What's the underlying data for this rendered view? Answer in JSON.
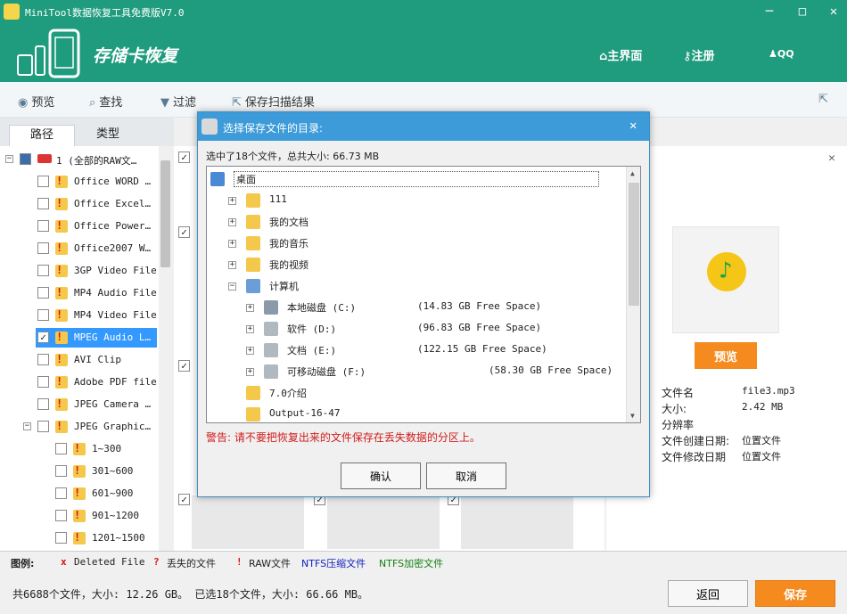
{
  "window": {
    "title": "MiniTool数据恢复工具免费版V7.0",
    "controls": [
      "─",
      "□",
      "✕"
    ]
  },
  "header": {
    "app_title": "存储卡恢复",
    "nav": {
      "home": "主界面",
      "register": "注册",
      "qq": "QQ"
    }
  },
  "toolbar": {
    "preview": "预览",
    "search": "查找",
    "filter": "过滤",
    "save_scan": "保存扫描结果"
  },
  "tabs": {
    "path": "路径",
    "type": "类型"
  },
  "tree": {
    "root": "1 (全部的RAW文…",
    "items": [
      {
        "label": "Office WORD …",
        "checked": false
      },
      {
        "label": "Office Excel…",
        "checked": false
      },
      {
        "label": "Office Power…",
        "checked": false
      },
      {
        "label": "Office2007 W…",
        "checked": false
      },
      {
        "label": "3GP Video File",
        "checked": false
      },
      {
        "label": "MP4 Audio File",
        "checked": false
      },
      {
        "label": "MP4 Video File",
        "checked": false
      },
      {
        "label": "MPEG Audio L…",
        "checked": true
      },
      {
        "label": "AVI Clip",
        "checked": false
      },
      {
        "label": "Adobe PDF file",
        "checked": false
      },
      {
        "label": "JPEG Camera …",
        "checked": false
      },
      {
        "label": "JPEG Graphic…",
        "checked": false
      }
    ],
    "subitems": [
      "1~300",
      "301~600",
      "601~900",
      "901~1200",
      "1201~1500"
    ]
  },
  "preview": {
    "button": "预览",
    "info": [
      {
        "label": "文件名",
        "value": "file3.mp3"
      },
      {
        "label": "大小:",
        "value": "2.42 MB"
      },
      {
        "label": "分辨率",
        "value": ""
      },
      {
        "label": "文件创建日期:",
        "value": "位置文件"
      },
      {
        "label": "文件修改日期",
        "value": "位置文件"
      }
    ]
  },
  "legend": {
    "title": "图例:",
    "deleted": "Deleted File",
    "lost": "丢失的文件",
    "raw": "RAW文件",
    "ntfs_comp": "NTFS压缩文件",
    "ntfs_enc": "NTFS加密文件",
    "colors": {
      "deleted": "#e01010",
      "lost": "#e01010",
      "raw": "#e01010",
      "ntfs_comp": "#1020c0",
      "ntfs_enc": "#108010"
    }
  },
  "status": {
    "text": "共6688个文件，大小: 12.26 GB。 已选18个文件，大小: 66.66 MB。",
    "back": "返回",
    "save": "保存"
  },
  "dialog": {
    "title": "选择保存文件的目录:",
    "summary": "选中了18个文件，总共大小: 66.73 MB",
    "tree": [
      {
        "label": "桌面",
        "free": ""
      },
      {
        "label": "111",
        "free": ""
      },
      {
        "label": "我的文档",
        "free": ""
      },
      {
        "label": "我的音乐",
        "free": ""
      },
      {
        "label": "我的视频",
        "free": ""
      },
      {
        "label": "计算机",
        "free": ""
      },
      {
        "label": "本地磁盘 (C:)",
        "free": "(14.83 GB Free Space)"
      },
      {
        "label": "软件 (D:)",
        "free": "(96.83 GB Free Space)"
      },
      {
        "label": "文档 (E:)",
        "free": "(122.15 GB Free Space)"
      },
      {
        "label": "可移动磁盘 (F:)",
        "free": "(58.30 GB Free Space)"
      },
      {
        "label": "7.0介绍",
        "free": ""
      },
      {
        "label": "Output-16-47",
        "free": ""
      }
    ],
    "warning": "警告: 请不要把恢复出来的文件保存在丢失数据的分区上。",
    "ok": "确认",
    "cancel": "取消"
  }
}
